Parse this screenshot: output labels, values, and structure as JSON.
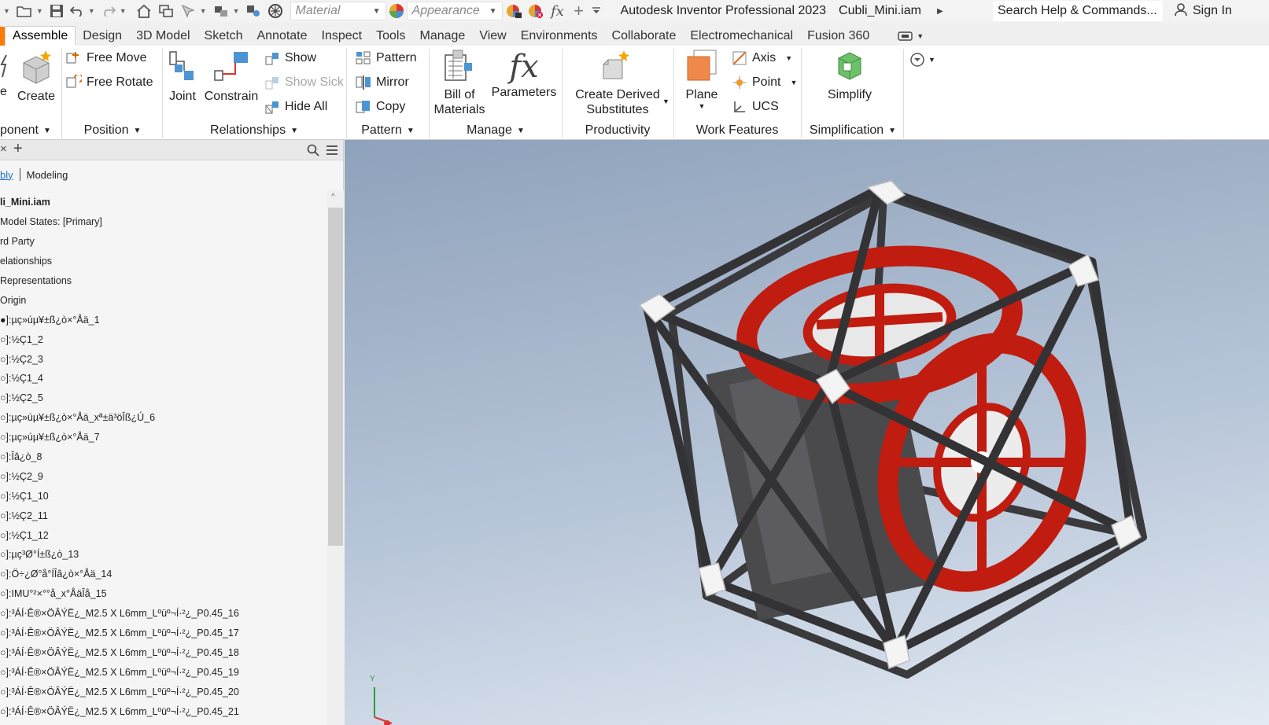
{
  "qat": {
    "material_placeholder": "Material",
    "appearance_placeholder": "Appearance",
    "fx_label": "fx",
    "app_title": "Autodesk Inventor Professional 2023",
    "file_name": "Cubli_Mini.iam",
    "search_placeholder": "Search Help & Commands...",
    "sign_in": "Sign In"
  },
  "tabs": [
    "Assemble",
    "Design",
    "3D Model",
    "Sketch",
    "Annotate",
    "Inspect",
    "Tools",
    "Manage",
    "View",
    "Environments",
    "Collaborate",
    "Electromechanical",
    "Fusion 360"
  ],
  "active_tab": "Assemble",
  "ribbon": {
    "component": {
      "create": "Create",
      "label": "ponent"
    },
    "position": {
      "free_move": "Free Move",
      "free_rotate": "Free Rotate",
      "label": "Position"
    },
    "relationships": {
      "joint": "Joint",
      "constrain": "Constrain",
      "show": "Show",
      "show_sick": "Show Sick",
      "hide_all": "Hide All",
      "label": "Relationships"
    },
    "pattern": {
      "pattern": "Pattern",
      "mirror": "Mirror",
      "copy": "Copy",
      "label": "Pattern"
    },
    "manage": {
      "bom_line1": "Bill of",
      "bom_line2": "Materials",
      "parameters": "Parameters",
      "fx": "fx",
      "label": "Manage"
    },
    "productivity": {
      "cds_line1": "Create Derived",
      "cds_line2": "Substitutes",
      "label": "Productivity"
    },
    "work_features": {
      "plane": "Plane",
      "axis": "Axis",
      "point": "Point",
      "ucs": "UCS",
      "label": "Work Features"
    },
    "simplification": {
      "simplify": "Simplify",
      "label": "Simplification"
    }
  },
  "browser": {
    "close_glyph": "×",
    "add_glyph": "+",
    "subtab_assembly": "bly",
    "subtab_modeling": "Modeling",
    "tree": [
      "li_Mini.iam",
      "Model States: [Primary]",
      "rd Party",
      "elationships",
      "Representations",
      "Origin",
      "●]:µç»úµ¥±ß¿ò×°Åä_1",
      "○]:½Ç1_2",
      "○]:½Ç2_3",
      "○]:½Ç1_4",
      "○]:½Ç2_5",
      "○]:µç»úµ¥±ß¿ò×°Åä_xª±ä³öÎß¿Ú_6",
      "○]:µç»úµ¥±ß¿ò×°Åä_7",
      "○]:Îâ¿ò_8",
      "○]:½Ç2_9",
      "○]:½Ç1_10",
      "○]:½Ç2_11",
      "○]:½Ç1_12",
      "○]:µç³Ø°Í±ß¿ò_13",
      "○]:Ö÷¿Ø°å°ÍÎâ¿ò×°Åä_14",
      "○]:IMU°²×°°å_x°ÅäÎå_15",
      "○]:³ÁÍ·Ê®×ÖÂÝË¿_M2.5 X L6mm_Lº­üº¬Í·²¿_P0.45_16",
      "○]:³ÁÍ·Ê®×ÖÂÝË¿_M2.5 X L6mm_Lº­üº¬Í·²¿_P0.45_17",
      "○]:³ÁÍ·Ê®×ÖÂÝË¿_M2.5 X L6mm_Lº­üº¬Í·²¿_P0.45_18",
      "○]:³ÁÍ·Ê®×ÖÂÝË¿_M2.5 X L6mm_Lº­üº¬Í·²¿_P0.45_19",
      "○]:³ÁÍ·Ê®×ÖÂÝË¿_M2.5 X L6mm_Lº­üº¬Í·²¿_P0.45_20",
      "○]:³ÁÍ·Ê®×ÖÂÝË¿_M2.5 X L6mm_Lº­üº¬Í·²¿_P0.45_21"
    ]
  },
  "viewport": {
    "triad_y_label": "Y"
  },
  "colors": {
    "accent": "#ff7a00",
    "wheel_red": "#c01c10",
    "frame_dark": "#3c3c3e",
    "corner_white": "#f4f4f4"
  }
}
